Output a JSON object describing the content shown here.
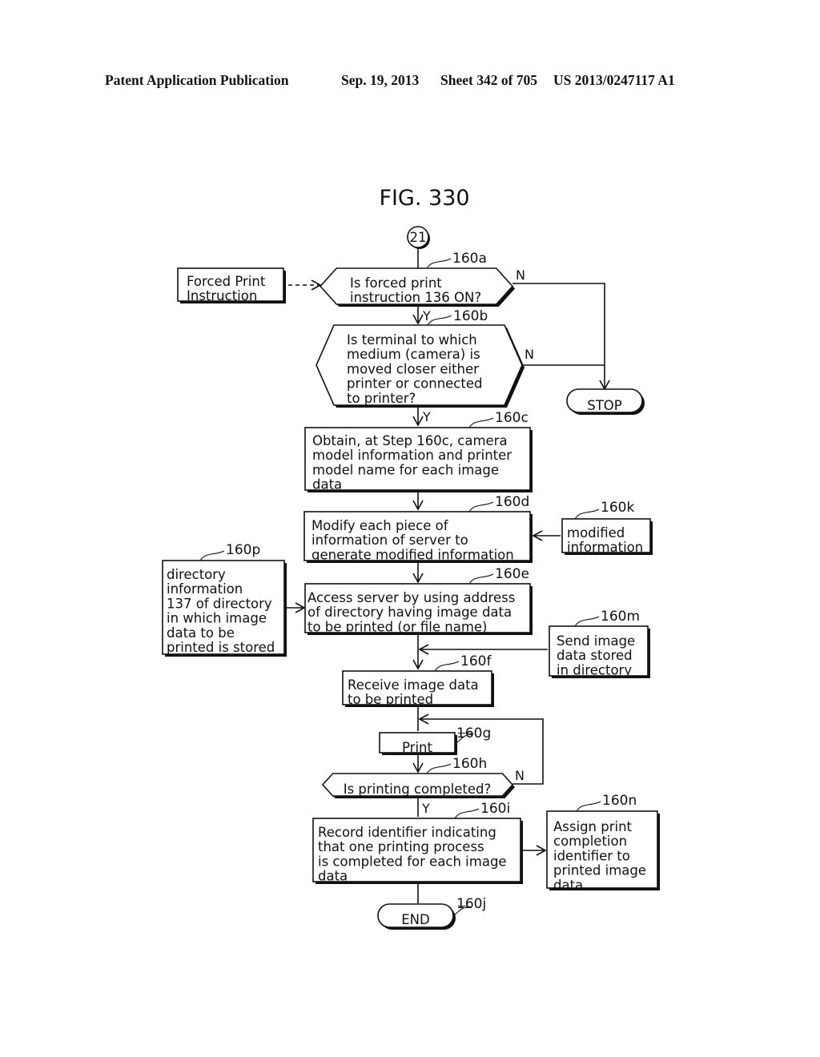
{
  "header": {
    "publication": "Patent Application Publication",
    "date": "Sep. 19, 2013",
    "sheet": "Sheet 342 of 705",
    "number": "US 2013/0247117 A1"
  },
  "figure": {
    "title": "FIG. 330",
    "connector": "21",
    "nodes": {
      "forced_print": {
        "lines": [
          "Forced Print",
          "Instruction"
        ]
      },
      "n160a": {
        "ref": "160a",
        "lines": [
          "Is forced print",
          "instruction 136 ON?"
        ]
      },
      "n160b": {
        "ref": "160b",
        "lines": [
          "Is terminal to which",
          "medium (camera) is",
          "moved closer either",
          "printer or connected",
          "to printer?"
        ]
      },
      "stop": {
        "lines": [
          "STOP"
        ]
      },
      "n160c": {
        "ref": "160c",
        "lines": [
          "Obtain, at Step 160c, camera",
          "model information and printer",
          "model name for each image",
          "data"
        ]
      },
      "n160d": {
        "ref": "160d",
        "lines": [
          "Modify each piece of",
          "information of server to",
          "generate modified information"
        ]
      },
      "n160k": {
        "ref": "160k",
        "lines": [
          "modified",
          "information"
        ]
      },
      "n160p": {
        "ref": "160p",
        "lines": [
          "directory",
          "information",
          "137 of directory",
          "in which image",
          "data to be",
          "printed is stored"
        ]
      },
      "n160e": {
        "ref": "160e",
        "lines": [
          "Access server by using address",
          "of directory having image data",
          "to be printed (or file name)"
        ]
      },
      "n160m": {
        "ref": "160m",
        "lines": [
          "Send image",
          "data stored",
          "in directory"
        ]
      },
      "n160f": {
        "ref": "160f",
        "lines": [
          "Receive image data",
          "to be printed"
        ]
      },
      "n160g": {
        "ref": "160g",
        "lines": [
          "Print"
        ]
      },
      "n160h": {
        "ref": "160h",
        "lines": [
          "Is printing completed?"
        ]
      },
      "n160i": {
        "ref": "160i",
        "lines": [
          "Record identifier indicating",
          "that one printing process",
          "is completed for each image",
          "data"
        ]
      },
      "n160n": {
        "ref": "160n",
        "lines": [
          "Assign print",
          "completion",
          "identifier to",
          "printed image",
          "data"
        ]
      },
      "n160j": {
        "ref": "160j",
        "lines": [
          "END"
        ]
      }
    },
    "branch_labels": {
      "yes": "Y",
      "no": "N"
    }
  }
}
